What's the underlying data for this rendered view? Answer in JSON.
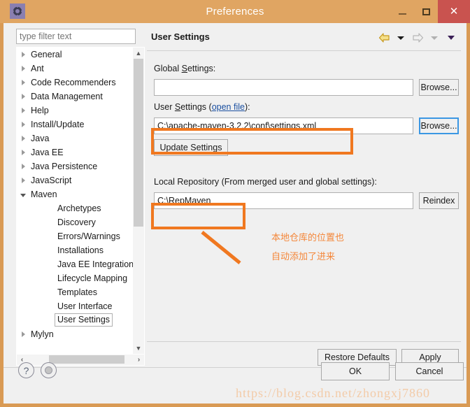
{
  "window": {
    "title": "Preferences",
    "app_icon": "gear-icon",
    "minimize_label": "Minimize",
    "maximize_label": "Maximize",
    "close_label": "✕"
  },
  "sidebar": {
    "filter_placeholder": "type filter text",
    "filter_value": "",
    "items": [
      {
        "label": "General",
        "level": 0,
        "state": "collapsed"
      },
      {
        "label": "Ant",
        "level": 0,
        "state": "collapsed"
      },
      {
        "label": "Code Recommenders",
        "level": 0,
        "state": "collapsed"
      },
      {
        "label": "Data Management",
        "level": 0,
        "state": "collapsed"
      },
      {
        "label": "Help",
        "level": 0,
        "state": "collapsed"
      },
      {
        "label": "Install/Update",
        "level": 0,
        "state": "collapsed"
      },
      {
        "label": "Java",
        "level": 0,
        "state": "collapsed"
      },
      {
        "label": "Java EE",
        "level": 0,
        "state": "collapsed"
      },
      {
        "label": "Java Persistence",
        "level": 0,
        "state": "collapsed"
      },
      {
        "label": "JavaScript",
        "level": 0,
        "state": "collapsed"
      },
      {
        "label": "Maven",
        "level": 0,
        "state": "expanded"
      },
      {
        "label": "Archetypes",
        "level": 1,
        "state": "leaf"
      },
      {
        "label": "Discovery",
        "level": 1,
        "state": "leaf"
      },
      {
        "label": "Errors/Warnings",
        "level": 1,
        "state": "leaf"
      },
      {
        "label": "Installations",
        "level": 1,
        "state": "leaf"
      },
      {
        "label": "Java EE Integration",
        "level": 1,
        "state": "leaf"
      },
      {
        "label": "Lifecycle Mapping",
        "level": 1,
        "state": "leaf"
      },
      {
        "label": "Templates",
        "level": 1,
        "state": "leaf"
      },
      {
        "label": "User Interface",
        "level": 1,
        "state": "leaf"
      },
      {
        "label": "User Settings",
        "level": 1,
        "state": "leaf",
        "selected": true
      },
      {
        "label": "Mylyn",
        "level": 0,
        "state": "collapsed"
      }
    ]
  },
  "content": {
    "page_title": "User Settings",
    "nav": {
      "back_icon": "arrow-left-icon",
      "back_menu_icon": "chevron-down-icon",
      "forward_icon": "arrow-right-icon",
      "forward_menu_icon": "chevron-down-icon",
      "view_menu_icon": "chevron-down-icon"
    },
    "global_settings": {
      "label_pre": "Global ",
      "label_mnemonic": "S",
      "label_post": "ettings:",
      "value": "",
      "browse_label": "Browse..."
    },
    "user_settings": {
      "label_pre": "User ",
      "label_mnemonic": "S",
      "label_mid": "ettings (",
      "link_label": "open file",
      "label_post": "):",
      "value": "C:\\apache-maven-3.2.2\\conf\\settings.xml",
      "browse_label": "Browse...",
      "update_label": "Update Settings"
    },
    "local_repository": {
      "label": "Local Repository (From merged user and global settings):",
      "value": "C:\\RepMaven",
      "reindex_label": "Reindex"
    },
    "restore_defaults_label": "Restore Defaults",
    "apply_label": "Apply"
  },
  "footer": {
    "help_label": "?",
    "secondary_icon": "circle-dot-icon",
    "ok_label": "OK",
    "cancel_label": "Cancel"
  },
  "annotation": {
    "line1": "本地仓库的位置也",
    "line2": "自动添加了进来",
    "color": "#f4873a"
  },
  "watermark": {
    "text": "https://blog.csdn.net/zhongxj7860"
  },
  "colors": {
    "titlebar": "#e0a562",
    "window_border": "#d99a54",
    "close_button": "#c9534f",
    "dialog_bg": "#f0f0f0",
    "highlight": "#f07820",
    "link": "#1a4fa0",
    "focus_border": "#3b97e3"
  }
}
